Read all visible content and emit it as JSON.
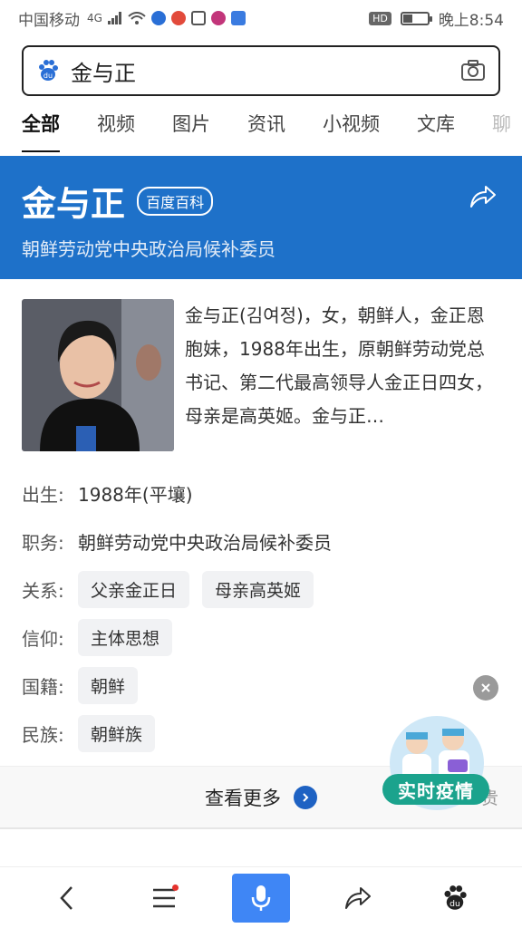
{
  "status_bar": {
    "carrier": "中国移动",
    "network": "4G",
    "hd": "HD",
    "time": "晚上8:54",
    "battery_level": 0.35
  },
  "search": {
    "query": "金与正"
  },
  "tabs": [
    {
      "label": "全部",
      "active": true
    },
    {
      "label": "视频"
    },
    {
      "label": "图片"
    },
    {
      "label": "资讯"
    },
    {
      "label": "小视频"
    },
    {
      "label": "文库"
    },
    {
      "label": "聊"
    }
  ],
  "hero": {
    "name": "金与正",
    "badge": "百度百科",
    "subtitle": "朝鲜劳动党中央政治局候补委员"
  },
  "summary": {
    "text": "金与正(김여정)，女，朝鲜人，金正恩胞妹，1988年出生，原朝鲜劳动党总书记、第二代最高领导人金正日四女，母亲是高英姬。金与正…"
  },
  "facts": {
    "birth": {
      "label": "出生:",
      "value": "1988年(平壤)"
    },
    "position": {
      "label": "职务:",
      "value": "朝鲜劳动党中央政治局候补委员"
    },
    "relations": {
      "label": "关系:",
      "chips": [
        "父亲金正日",
        "母亲高英姬"
      ]
    },
    "belief": {
      "label": "信仰:",
      "chips": [
        "主体思想"
      ]
    },
    "nationality": {
      "label": "国籍:",
      "chips": [
        "朝鲜"
      ]
    },
    "ethnicity": {
      "label": "民族:",
      "chips": [
        "朝鲜族"
      ]
    }
  },
  "more": {
    "label": "查看更多",
    "partial_right": "贵"
  },
  "float_badge": {
    "label": "实时疫情"
  },
  "colors": {
    "hero_blue": "#1e71c9",
    "accent_blue": "#3f86f5",
    "badge_green": "#1ba38d"
  }
}
